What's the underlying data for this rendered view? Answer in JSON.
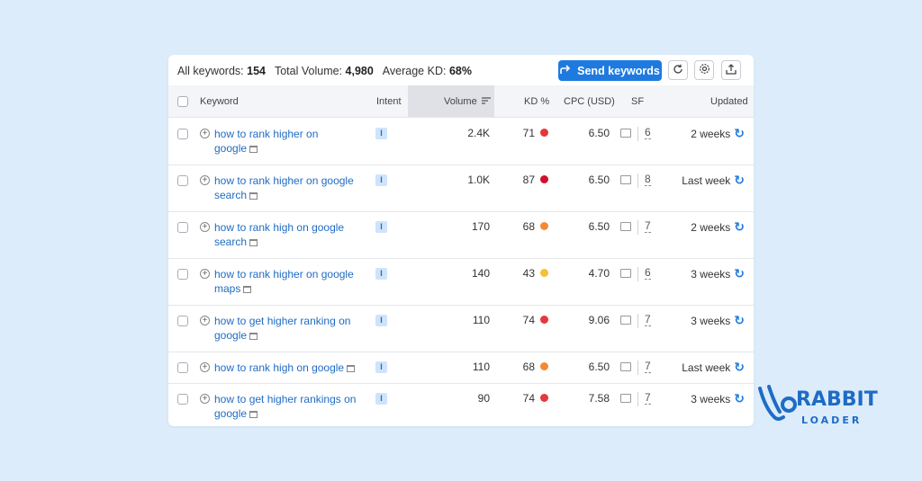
{
  "summary": {
    "all_keywords_label": "All keywords:",
    "all_keywords_value": "154",
    "total_volume_label": "Total Volume:",
    "total_volume_value": "4,980",
    "avg_kd_label": "Average KD:",
    "avg_kd_value": "68%"
  },
  "toolbar": {
    "send_label": "Send keywords",
    "refresh_icon": "refresh-icon",
    "settings_icon": "gear-icon",
    "export_icon": "export-icon"
  },
  "columns": {
    "keyword": "Keyword",
    "intent": "Intent",
    "volume": "Volume",
    "kd": "KD %",
    "cpc": "CPC (USD)",
    "sf": "SF",
    "updated": "Updated"
  },
  "colors": {
    "accent": "#1f7ae0",
    "kd_hard": "#e5383b",
    "kd_very_hard": "#d0102c",
    "kd_medium": "#f38a33",
    "kd_possible": "#f5c131"
  },
  "rows": [
    {
      "kw1": "how to rank higher on",
      "kw2": "google",
      "intent": "I",
      "volume": "2.4K",
      "kd": "71",
      "kd_color": "#e5383b",
      "cpc": "6.50",
      "sf": "6",
      "updated": "2 weeks"
    },
    {
      "kw1": "how to rank higher on google",
      "kw2": "search",
      "intent": "I",
      "volume": "1.0K",
      "kd": "87",
      "kd_color": "#d0102c",
      "cpc": "6.50",
      "sf": "8",
      "updated": "Last week"
    },
    {
      "kw1": "how to rank high on google",
      "kw2": "search",
      "intent": "I",
      "volume": "170",
      "kd": "68",
      "kd_color": "#f38a33",
      "cpc": "6.50",
      "sf": "7",
      "updated": "2 weeks"
    },
    {
      "kw1": "how to rank higher on google",
      "kw2": "maps",
      "intent": "I",
      "volume": "140",
      "kd": "43",
      "kd_color": "#f5c131",
      "cpc": "4.70",
      "sf": "6",
      "updated": "3 weeks"
    },
    {
      "kw1": "how to get higher ranking on",
      "kw2": "google",
      "intent": "I",
      "volume": "110",
      "kd": "74",
      "kd_color": "#e5383b",
      "cpc": "9.06",
      "sf": "7",
      "updated": "3 weeks"
    },
    {
      "kw1": "how to rank high on google",
      "kw2": "",
      "intent": "I",
      "volume": "110",
      "kd": "68",
      "kd_color": "#f38a33",
      "cpc": "6.50",
      "sf": "7",
      "updated": "Last week"
    },
    {
      "kw1": "how to get higher rankings on",
      "kw2": "google",
      "intent": "I",
      "volume": "90",
      "kd": "74",
      "kd_color": "#e5383b",
      "cpc": "7.58",
      "sf": "7",
      "updated": "3 weeks"
    }
  ],
  "logo": {
    "title": "RABBIT",
    "subtitle": "LOADER"
  }
}
